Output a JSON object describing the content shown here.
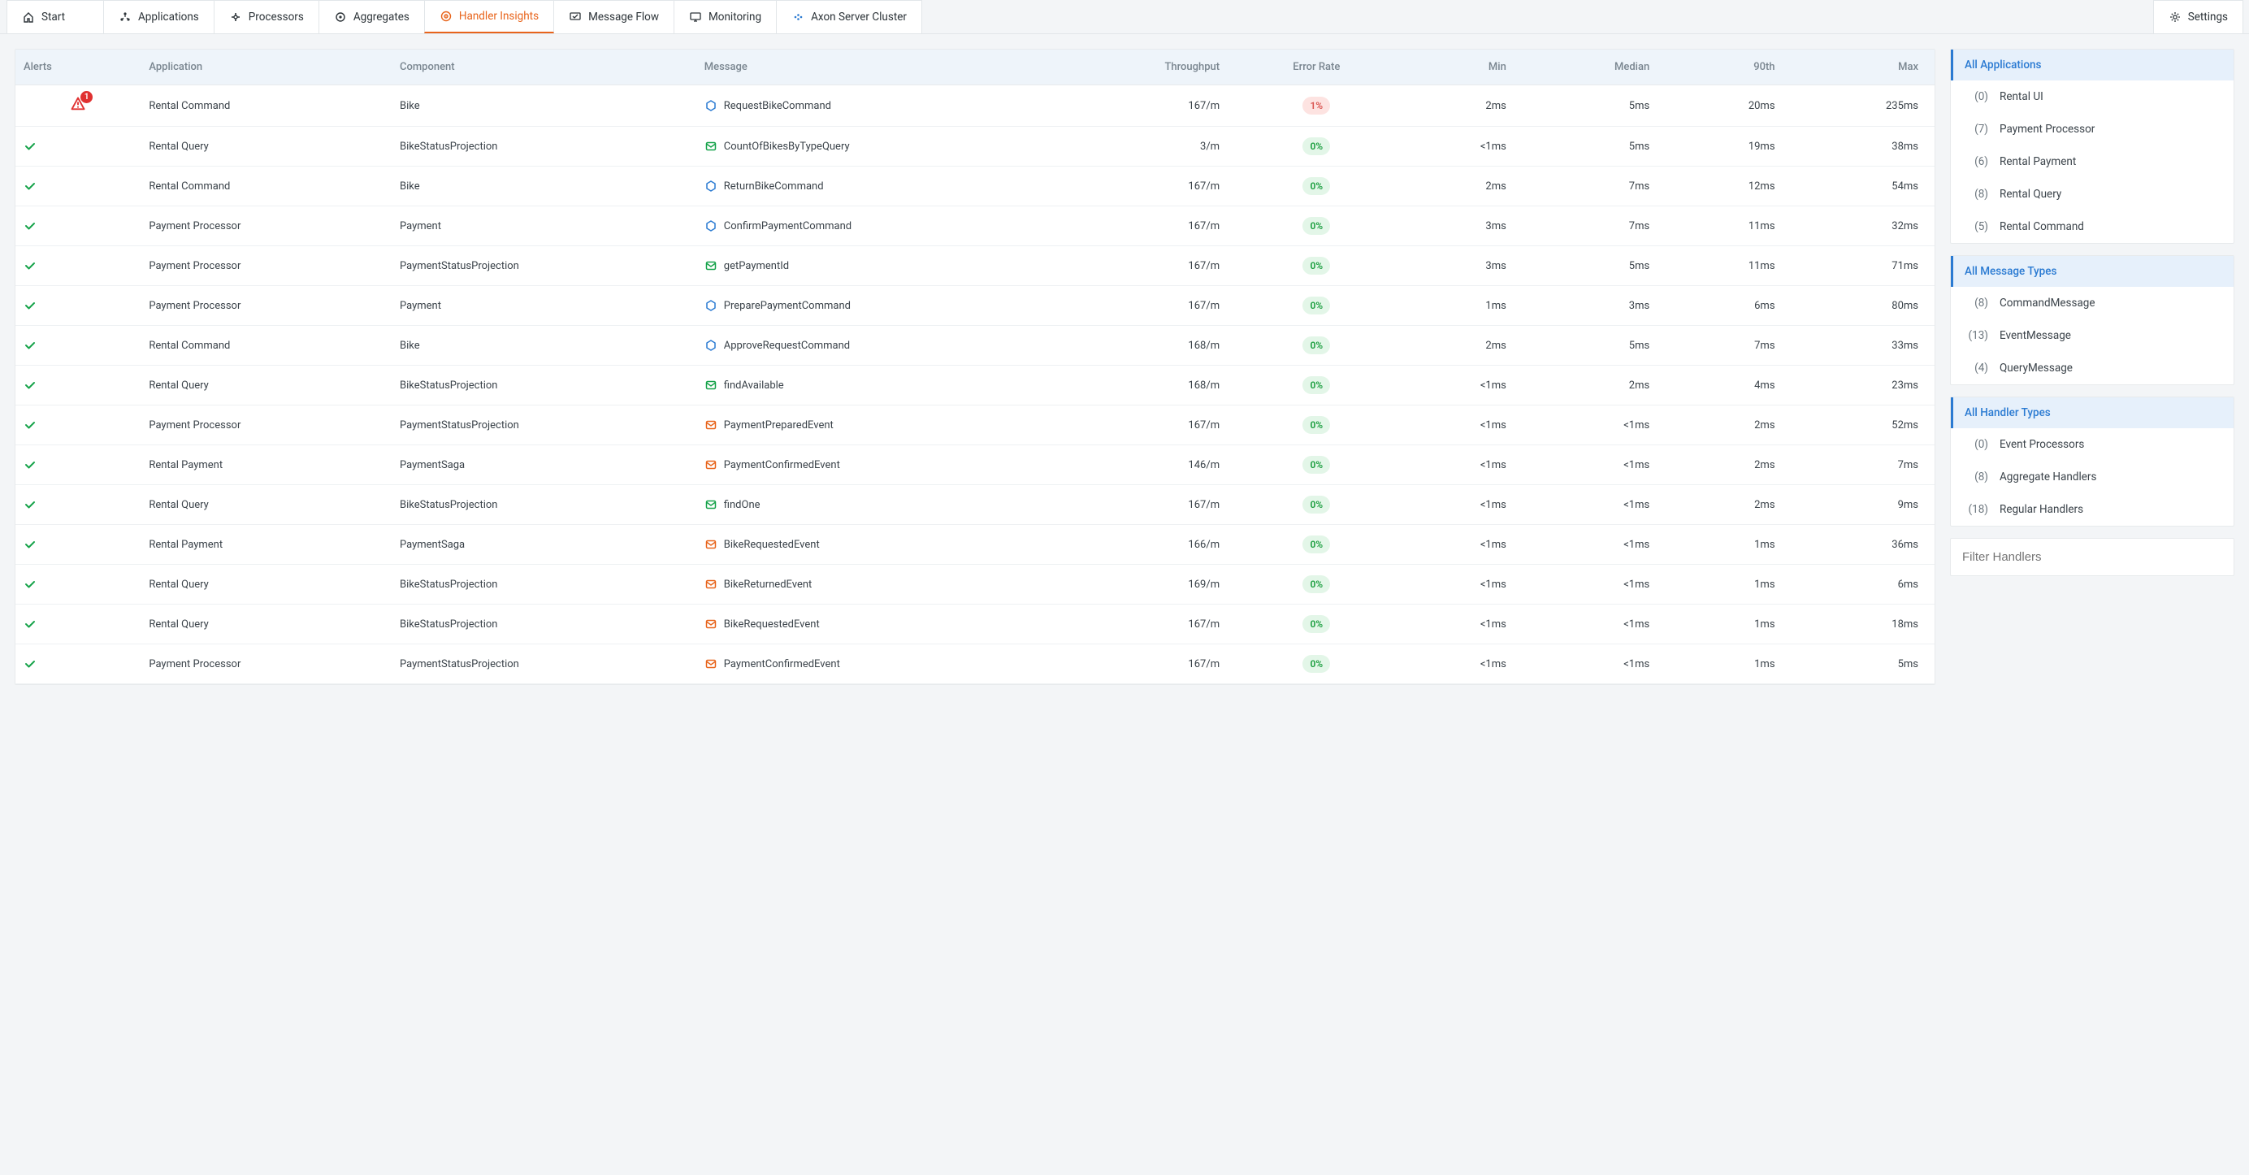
{
  "tabs": {
    "start": "Start",
    "applications": "Applications",
    "processors": "Processors",
    "aggregates": "Aggregates",
    "handler_insights": "Handler Insights",
    "message_flow": "Message Flow",
    "monitoring": "Monitoring",
    "axon_cluster": "Axon Server Cluster",
    "settings": "Settings"
  },
  "columns": {
    "alerts": "Alerts",
    "application": "Application",
    "component": "Component",
    "message": "Message",
    "throughput": "Throughput",
    "error_rate": "Error Rate",
    "min": "Min",
    "median": "Median",
    "p90": "90th",
    "max": "Max"
  },
  "rows": [
    {
      "alert": "warn",
      "alert_count": "1",
      "app": "Rental Command",
      "component": "Bike",
      "msg_type": "command",
      "msg": "RequestBikeCommand",
      "tp": "167/m",
      "err": "1%",
      "err_state": "err",
      "min": "2ms",
      "median": "5ms",
      "p90": "20ms",
      "max": "235ms"
    },
    {
      "alert": "ok",
      "app": "Rental Query",
      "component": "BikeStatusProjection",
      "msg_type": "query",
      "msg": "CountOfBikesByTypeQuery",
      "tp": "3/m",
      "err": "0%",
      "err_state": "ok",
      "min": "<1ms",
      "median": "5ms",
      "p90": "19ms",
      "max": "38ms"
    },
    {
      "alert": "ok",
      "app": "Rental Command",
      "component": "Bike",
      "msg_type": "command",
      "msg": "ReturnBikeCommand",
      "tp": "167/m",
      "err": "0%",
      "err_state": "ok",
      "min": "2ms",
      "median": "7ms",
      "p90": "12ms",
      "max": "54ms"
    },
    {
      "alert": "ok",
      "app": "Payment Processor",
      "component": "Payment",
      "msg_type": "command",
      "msg": "ConfirmPaymentCommand",
      "tp": "167/m",
      "err": "0%",
      "err_state": "ok",
      "min": "3ms",
      "median": "7ms",
      "p90": "11ms",
      "max": "32ms"
    },
    {
      "alert": "ok",
      "app": "Payment Processor",
      "component": "PaymentStatusProjection",
      "msg_type": "query",
      "msg": "getPaymentId",
      "tp": "167/m",
      "err": "0%",
      "err_state": "ok",
      "min": "3ms",
      "median": "5ms",
      "p90": "11ms",
      "max": "71ms"
    },
    {
      "alert": "ok",
      "app": "Payment Processor",
      "component": "Payment",
      "msg_type": "command",
      "msg": "PreparePaymentCommand",
      "tp": "167/m",
      "err": "0%",
      "err_state": "ok",
      "min": "1ms",
      "median": "3ms",
      "p90": "6ms",
      "max": "80ms"
    },
    {
      "alert": "ok",
      "app": "Rental Command",
      "component": "Bike",
      "msg_type": "command",
      "msg": "ApproveRequestCommand",
      "tp": "168/m",
      "err": "0%",
      "err_state": "ok",
      "min": "2ms",
      "median": "5ms",
      "p90": "7ms",
      "max": "33ms"
    },
    {
      "alert": "ok",
      "app": "Rental Query",
      "component": "BikeStatusProjection",
      "msg_type": "query",
      "msg": "findAvailable",
      "tp": "168/m",
      "err": "0%",
      "err_state": "ok",
      "min": "<1ms",
      "median": "2ms",
      "p90": "4ms",
      "max": "23ms"
    },
    {
      "alert": "ok",
      "app": "Payment Processor",
      "component": "PaymentStatusProjection",
      "msg_type": "event",
      "msg": "PaymentPreparedEvent",
      "tp": "167/m",
      "err": "0%",
      "err_state": "ok",
      "min": "<1ms",
      "median": "<1ms",
      "p90": "2ms",
      "max": "52ms"
    },
    {
      "alert": "ok",
      "app": "Rental Payment",
      "component": "PaymentSaga",
      "msg_type": "event",
      "msg": "PaymentConfirmedEvent",
      "tp": "146/m",
      "err": "0%",
      "err_state": "ok",
      "min": "<1ms",
      "median": "<1ms",
      "p90": "2ms",
      "max": "7ms"
    },
    {
      "alert": "ok",
      "app": "Rental Query",
      "component": "BikeStatusProjection",
      "msg_type": "query",
      "msg": "findOne",
      "tp": "167/m",
      "err": "0%",
      "err_state": "ok",
      "min": "<1ms",
      "median": "<1ms",
      "p90": "2ms",
      "max": "9ms"
    },
    {
      "alert": "ok",
      "app": "Rental Payment",
      "component": "PaymentSaga",
      "msg_type": "event",
      "msg": "BikeRequestedEvent",
      "tp": "166/m",
      "err": "0%",
      "err_state": "ok",
      "min": "<1ms",
      "median": "<1ms",
      "p90": "1ms",
      "max": "36ms"
    },
    {
      "alert": "ok",
      "app": "Rental Query",
      "component": "BikeStatusProjection",
      "msg_type": "event",
      "msg": "BikeReturnedEvent",
      "tp": "169/m",
      "err": "0%",
      "err_state": "ok",
      "min": "<1ms",
      "median": "<1ms",
      "p90": "1ms",
      "max": "6ms"
    },
    {
      "alert": "ok",
      "app": "Rental Query",
      "component": "BikeStatusProjection",
      "msg_type": "event",
      "msg": "BikeRequestedEvent",
      "tp": "167/m",
      "err": "0%",
      "err_state": "ok",
      "min": "<1ms",
      "median": "<1ms",
      "p90": "1ms",
      "max": "18ms"
    },
    {
      "alert": "ok",
      "app": "Payment Processor",
      "component": "PaymentStatusProjection",
      "msg_type": "event",
      "msg": "PaymentConfirmedEvent",
      "tp": "167/m",
      "err": "0%",
      "err_state": "ok",
      "min": "<1ms",
      "median": "<1ms",
      "p90": "1ms",
      "max": "5ms"
    }
  ],
  "sidebar": {
    "applications": {
      "title": "All Applications",
      "items": [
        {
          "count": "(0)",
          "label": "Rental UI"
        },
        {
          "count": "(7)",
          "label": "Payment Processor"
        },
        {
          "count": "(6)",
          "label": "Rental Payment"
        },
        {
          "count": "(8)",
          "label": "Rental Query"
        },
        {
          "count": "(5)",
          "label": "Rental Command"
        }
      ]
    },
    "message_types": {
      "title": "All Message Types",
      "items": [
        {
          "count": "(8)",
          "label": "CommandMessage"
        },
        {
          "count": "(13)",
          "label": "EventMessage"
        },
        {
          "count": "(4)",
          "label": "QueryMessage"
        }
      ]
    },
    "handler_types": {
      "title": "All Handler Types",
      "items": [
        {
          "count": "(0)",
          "label": "Event Processors"
        },
        {
          "count": "(8)",
          "label": "Aggregate Handlers"
        },
        {
          "count": "(18)",
          "label": "Regular Handlers"
        }
      ]
    },
    "filter_placeholder": "Filter Handlers"
  }
}
